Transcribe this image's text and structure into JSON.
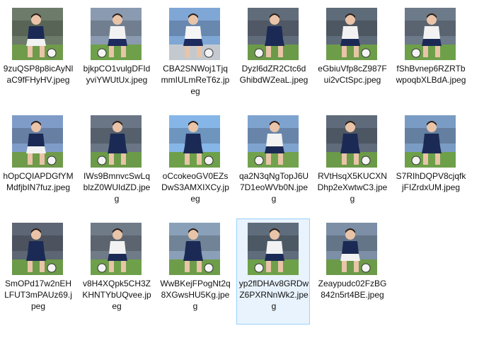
{
  "files": [
    {
      "name": "9zuQSP8p8icAyNlaC9fFHyHV.jpeg",
      "bg": "#6c7b6a",
      "shirt": "#1b2a55",
      "shorts": "#f2f2f2",
      "ground": "#6f9b4b",
      "icon": "image-thumbnail-icon"
    },
    {
      "name": "bjkpCO1vulgDFIdyviYWUtUx.jpeg",
      "bg": "#8a9ab0",
      "shirt": "#f2f2f2",
      "shorts": "#1d2b5e",
      "ground": "#6ea04a",
      "icon": "image-thumbnail-icon"
    },
    {
      "name": "CBA2SNWoj1TjqmmIULmReT6z.jpeg",
      "bg": "#7fa7d6",
      "shirt": "#f5f5f5",
      "shorts": "#1d2b5e",
      "ground": "#c4c9cf",
      "icon": "image-thumbnail-icon"
    },
    {
      "name": "Dyzl6dZR2Ctc6dGhibdWZeaL.jpeg",
      "bg": "#616c7a",
      "shirt": "#1b2a55",
      "shorts": "#1b2a55",
      "ground": "#6b9a48",
      "icon": "image-thumbnail-icon"
    },
    {
      "name": "eGbiuVfp8cZ987Fui2vCtSpc.jpeg",
      "bg": "#5e6b78",
      "shirt": "#f2f2f2",
      "shorts": "#1b2a55",
      "ground": "#6d9d49",
      "icon": "image-thumbnail-icon"
    },
    {
      "name": "fShBvnep6RZRTbwpoqbXLBdA.jpeg",
      "bg": "#6d7a89",
      "shirt": "#f2f2f2",
      "shorts": "#1b2a55",
      "ground": "#6ea04a",
      "icon": "image-thumbnail-icon"
    },
    {
      "name": "hOpCQIAPDGfYMMdfjbIN7fuz.jpeg",
      "bg": "#7f9cc9",
      "shirt": "#1b2a55",
      "shorts": "#f2f2f2",
      "ground": "#6f9b4b",
      "icon": "image-thumbnail-icon"
    },
    {
      "name": "IWs9BmnvcSwLqblzZ0WUIdZD.jpeg",
      "bg": "#6a7686",
      "shirt": "#1b2a55",
      "shorts": "#1b2a55",
      "ground": "#6b9a48",
      "icon": "image-thumbnail-icon"
    },
    {
      "name": "oCcokeoGV0EZsDwS3AMXIXCy.jpeg",
      "bg": "#86b6e8",
      "shirt": "#1b2a55",
      "shorts": "#1b2a55",
      "ground": "#6ea04a",
      "icon": "image-thumbnail-icon"
    },
    {
      "name": "qa2N3qNgTopJ6U7D1eoWVb0N.jpeg",
      "bg": "#7fa3cf",
      "shirt": "#f2f2f2",
      "shorts": "#1b2a55",
      "ground": "#72a24d",
      "icon": "image-thumbnail-icon"
    },
    {
      "name": "RVtHsqX5KUCXNDhp2eXwtwC3.jpeg",
      "bg": "#5f6b7a",
      "shirt": "#1b2a55",
      "shorts": "#1b2a55",
      "ground": "#6b9a48",
      "icon": "image-thumbnail-icon"
    },
    {
      "name": "S7RIhDQPV8cjqfkjFIZrdxUM.jpeg",
      "bg": "#7a9cc4",
      "shirt": "#1b2a55",
      "shorts": "#1b2a55",
      "ground": "#6ea04a",
      "icon": "image-thumbnail-icon"
    },
    {
      "name": "SmOPd17w2nEHLFUT3mPAUz69.jpeg",
      "bg": "#5d6674",
      "shirt": "#1b2a55",
      "shorts": "#1b2a55",
      "ground": "#6b9a48",
      "icon": "image-thumbnail-icon"
    },
    {
      "name": "v8H4XQpk5CH3ZKHNTYbUQvee.jpeg",
      "bg": "#707b88",
      "shirt": "#f2f2f2",
      "shorts": "#1b2a55",
      "ground": "#6ea04a",
      "icon": "image-thumbnail-icon"
    },
    {
      "name": "WwBKejFPogNt2q8XGwsHU5Kg.jpeg",
      "bg": "#8aa0b8",
      "shirt": "#1b2a55",
      "shorts": "#1b2a55",
      "ground": "#6d9d49",
      "icon": "image-thumbnail-icon"
    },
    {
      "name": "yp2flDHAv8GRDwZ6PXRNnWk2.jpeg",
      "bg": "#5f6c7c",
      "shirt": "#f2f2f2",
      "shorts": "#1b2a55",
      "ground": "#6ea04a",
      "icon": "image-thumbnail-icon",
      "selected": true
    },
    {
      "name": "Zeaypudc02FzBG842n5rt4BE.jpeg",
      "bg": "#7c8fa6",
      "shirt": "#1b2a55",
      "shorts": "#f2f2f2",
      "ground": "#6b9a48",
      "icon": "image-thumbnail-icon"
    }
  ]
}
